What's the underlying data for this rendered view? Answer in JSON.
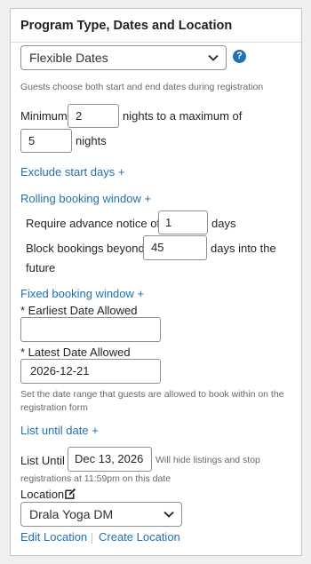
{
  "panel": {
    "title": "Program Type, Dates and Location"
  },
  "program_type": {
    "selected": "Flexible Dates",
    "help_glyph": "?",
    "description": "Guests choose both start and end dates during registration"
  },
  "nights": {
    "minimum_label": "Minimum",
    "minimum_value": "2",
    "maximum_label": "nights to a maximum of",
    "maximum_value": "5",
    "suffix": "nights"
  },
  "exclude_start_days": {
    "label": "Exclude start days +"
  },
  "rolling_window": {
    "toggle_label": "Rolling booking window +",
    "advance_label": "Require advance notice of",
    "advance_value": "1",
    "advance_suffix": "days",
    "block_label": "Block bookings beyond",
    "block_value": "45",
    "block_suffix_line1": "days into the",
    "block_suffix_line2": "future"
  },
  "fixed_window": {
    "toggle_label": "Fixed booking window +",
    "earliest_label": "* Earliest Date Allowed",
    "earliest_value": "",
    "latest_label": "* Latest Date Allowed",
    "latest_value": "2026-12-21",
    "description_line1": "Set the date range that guests are allowed to book within on the",
    "description_line2": "registration form"
  },
  "list_until": {
    "toggle_label": "List until date +",
    "label": "List Until",
    "value": "Dec 13, 2026",
    "hint_line1": "Will hide listings and stop",
    "hint_line2": "registrations at 11:59pm on this date"
  },
  "location": {
    "label": "Location",
    "edit_icon": "edit-icon",
    "selected": "Drala Yoga DM",
    "edit_link": "Edit Location",
    "create_link": "Create Location"
  },
  "colors": {
    "link": "#2271b1",
    "border": "#8c8f94",
    "muted": "#646970"
  }
}
